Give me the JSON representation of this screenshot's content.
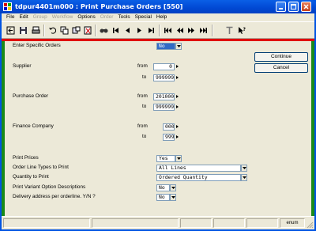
{
  "window": {
    "title": "tdpur4401m000 : Print Purchase Orders [550]"
  },
  "menubar": {
    "items": [
      {
        "label": "File",
        "enabled": true
      },
      {
        "label": "Edit",
        "enabled": true
      },
      {
        "label": "Group",
        "enabled": false
      },
      {
        "label": "Workflow",
        "enabled": false
      },
      {
        "label": "Options",
        "enabled": true
      },
      {
        "label": "Order",
        "enabled": false
      },
      {
        "label": "Tools",
        "enabled": true
      },
      {
        "label": "Special",
        "enabled": true
      },
      {
        "label": "Help",
        "enabled": true
      }
    ]
  },
  "toolbar": {
    "icons": [
      "exit-icon",
      "save-icon",
      "print-icon",
      "undo-icon",
      "copy-icon",
      "copy-record-icon",
      "delete-icon",
      "find-icon",
      "first-record-icon",
      "previous-record-icon",
      "next-record-icon",
      "last-record-icon",
      "first-group-icon",
      "previous-group-icon",
      "next-group-icon",
      "last-group-icon",
      "text-icon",
      "help-pointer-icon"
    ]
  },
  "form": {
    "specific_orders": {
      "label": "Enter Specific Orders",
      "value": "No"
    },
    "supplier": {
      "label": "Supplier",
      "from_label": "from",
      "to_label": "to",
      "from": "0",
      "to": "999999"
    },
    "purchase_order": {
      "label": "Purchase Order",
      "from_label": "from",
      "to_label": "to",
      "from": "201000",
      "to": "999999"
    },
    "finance_company": {
      "label": "Finance Company",
      "from_label": "from",
      "to_label": "to",
      "from": "000",
      "to": "999"
    },
    "print_prices": {
      "label": "Print Prices",
      "value": "Yes"
    },
    "order_line_types": {
      "label": "Order Line Types to Print",
      "value": "All Lines"
    },
    "quantity_to_print": {
      "label": "Quantity to Print",
      "value": "Ordered Quantity"
    },
    "variant_option": {
      "label": "Print Variant Option Descriptions",
      "value": "No"
    },
    "delivery_address": {
      "label": "Delivery address per orderline. Y/N ?",
      "value": "No"
    }
  },
  "buttons": {
    "continue": "Continue",
    "cancel": "Cancel"
  },
  "statusbar": {
    "lang": "enum"
  },
  "colors": {
    "title_blue": "#0054e3",
    "window_bg": "#ece9d8",
    "accent_red": "#e0000b",
    "accent_green": "#1a8a1a",
    "selection": "#316ac5"
  }
}
